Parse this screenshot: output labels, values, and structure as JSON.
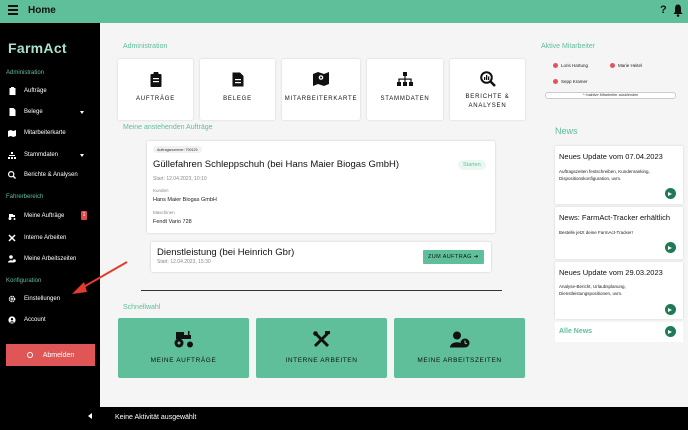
{
  "topbar": {
    "title": "Home",
    "help": "?"
  },
  "sidebar": {
    "logo": "FarmAct",
    "sections": {
      "admin": "Administration",
      "driver": "Fahrerbereich",
      "config": "Konfiguration"
    },
    "items": [
      {
        "label": "Aufträge"
      },
      {
        "label": "Belege"
      },
      {
        "label": "Mitarbeiterkarte"
      },
      {
        "label": "Stammdaten"
      },
      {
        "label": "Berichte & Analysen"
      },
      {
        "label": "Meine Aufträge",
        "badge": "1"
      },
      {
        "label": "Interne Arbeiten"
      },
      {
        "label": "Meine Arbeitszeiten"
      },
      {
        "label": "Einstellungen"
      },
      {
        "label": "Account"
      }
    ],
    "logout": "Abmelden"
  },
  "headings": {
    "administration": "Administration",
    "pending": "Meine anstehenden Aufträge",
    "quick": "Schnellwahl",
    "active_staff": "Aktive Mitarbeiter",
    "news": "News"
  },
  "admin_tiles": [
    {
      "label": "AUFTRÄGE"
    },
    {
      "label": "BELEGE"
    },
    {
      "label": "MITARBEITERKARTE"
    },
    {
      "label": "STAMMDATEN"
    },
    {
      "label": "BERICHTE &\nANALYSEN"
    }
  ],
  "order1": {
    "number": "Auftragsnummer: 799129",
    "title": "Güllefahren Schleppschuh (bei Hans Maier Biogas GmbH)",
    "start": "Start: 12.04.2023, 10:10",
    "customer_label": "Kunden",
    "customer": "Hans Maier Biogas GmbH",
    "machines_label": "Maschinen",
    "machine": "Fendt Vario 728",
    "start_button": "Starten"
  },
  "order2": {
    "title": "Dienstleistung (bei Heinrich Gbr)",
    "start": "Start: 12.04.2023, 15:30",
    "button": "ZUM AUFTRAG ➔"
  },
  "quick_tiles": [
    {
      "label": "MEINE AUFTRÄGE"
    },
    {
      "label": "INTERNE ARBEITEN"
    },
    {
      "label": "MEINE ARBEITSZEITEN"
    }
  ],
  "active_staff": [
    {
      "name": "Loris Hartung"
    },
    {
      "name": "Marie Heitel"
    },
    {
      "name": "Sepp Kramer"
    }
  ],
  "hide_staff_button": "^ Inaktive Mitarbeiter ausblenden",
  "news": [
    {
      "title": "Neues Update vom 07.04.2023",
      "body": "Auftragszeiten festschreiben, Kundenranking, Dispositionskonfiguration, uvm."
    },
    {
      "title": "News: FarmAct-Tracker erhältlich",
      "body": "Bestelle jetzt deine FarmAct-Tracker!"
    },
    {
      "title": "Neues Update vom 29.03.2023",
      "body": "Analyse-Bericht, Urlaubsplanung, Dienstleistungspositionen, uvm."
    }
  ],
  "all_news": "Alle News",
  "bottombar": {
    "status": "Keine Aktivität ausgewählt"
  },
  "colors": {
    "accent": "#5fbf9a",
    "danger": "#e05555",
    "dark_green": "#1f7a55"
  }
}
